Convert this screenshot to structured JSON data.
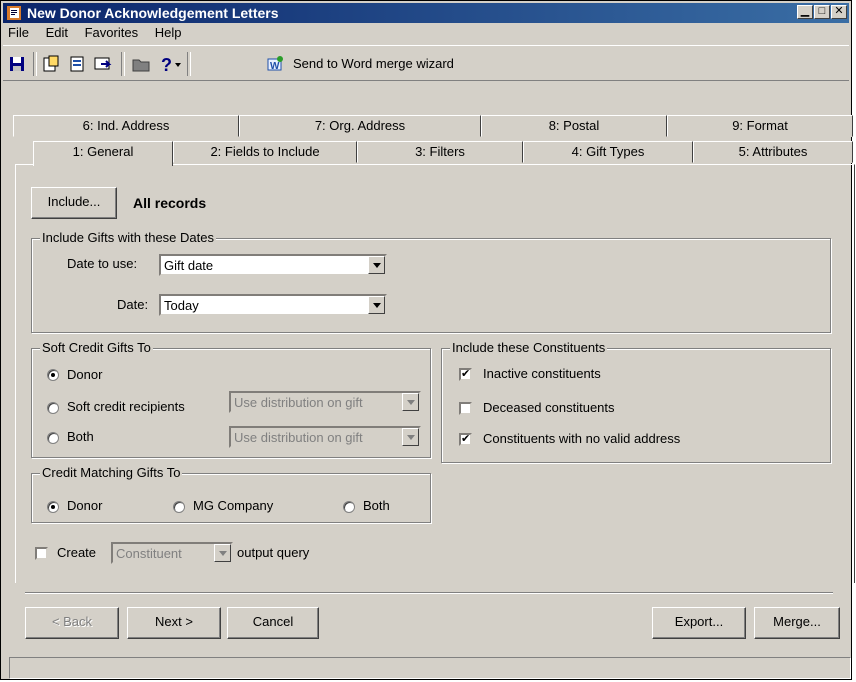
{
  "window": {
    "title": "New Donor Acknowledgement Letters"
  },
  "menu": [
    "File",
    "Edit",
    "Favorites",
    "Help"
  ],
  "toolbar": {
    "merge_wizard_label": "Send to Word merge wizard"
  },
  "tabs_back": [
    "6: Ind. Address",
    "7: Org. Address",
    "8: Postal",
    "9: Format"
  ],
  "tabs_front": [
    "1: General",
    "2: Fields to Include",
    "3: Filters",
    "4: Gift Types",
    "5: Attributes"
  ],
  "general": {
    "include_button": "Include...",
    "include_value": "All records",
    "dates_group": {
      "legend": "Include Gifts with these Dates",
      "date_to_use_label": "Date to use:",
      "date_to_use_value": "Gift date",
      "date_label": "Date:",
      "date_value": "Today"
    },
    "soft_credit": {
      "legend": "Soft Credit Gifts To",
      "donor": "Donor",
      "recipients": "Soft credit recipients",
      "both": "Both",
      "recipients_combo": "Use distribution on gift",
      "both_combo": "Use distribution on gift",
      "selected": "Donor"
    },
    "matching": {
      "legend": "Credit Matching Gifts To",
      "donor": "Donor",
      "mg_company": "MG Company",
      "both": "Both",
      "selected": "Donor"
    },
    "constituents": {
      "legend": "Include these Constituents",
      "inactive": "Inactive constituents",
      "inactive_checked": true,
      "deceased": "Deceased constituents",
      "deceased_checked": false,
      "no_address": "Constituents with no valid address",
      "no_address_checked": true
    },
    "output": {
      "create_label": "Create",
      "type_value": "Constituent",
      "suffix": "output query"
    }
  },
  "buttons": {
    "back": "< Back",
    "next": "Next >",
    "cancel": "Cancel",
    "export": "Export...",
    "merge": "Merge..."
  }
}
